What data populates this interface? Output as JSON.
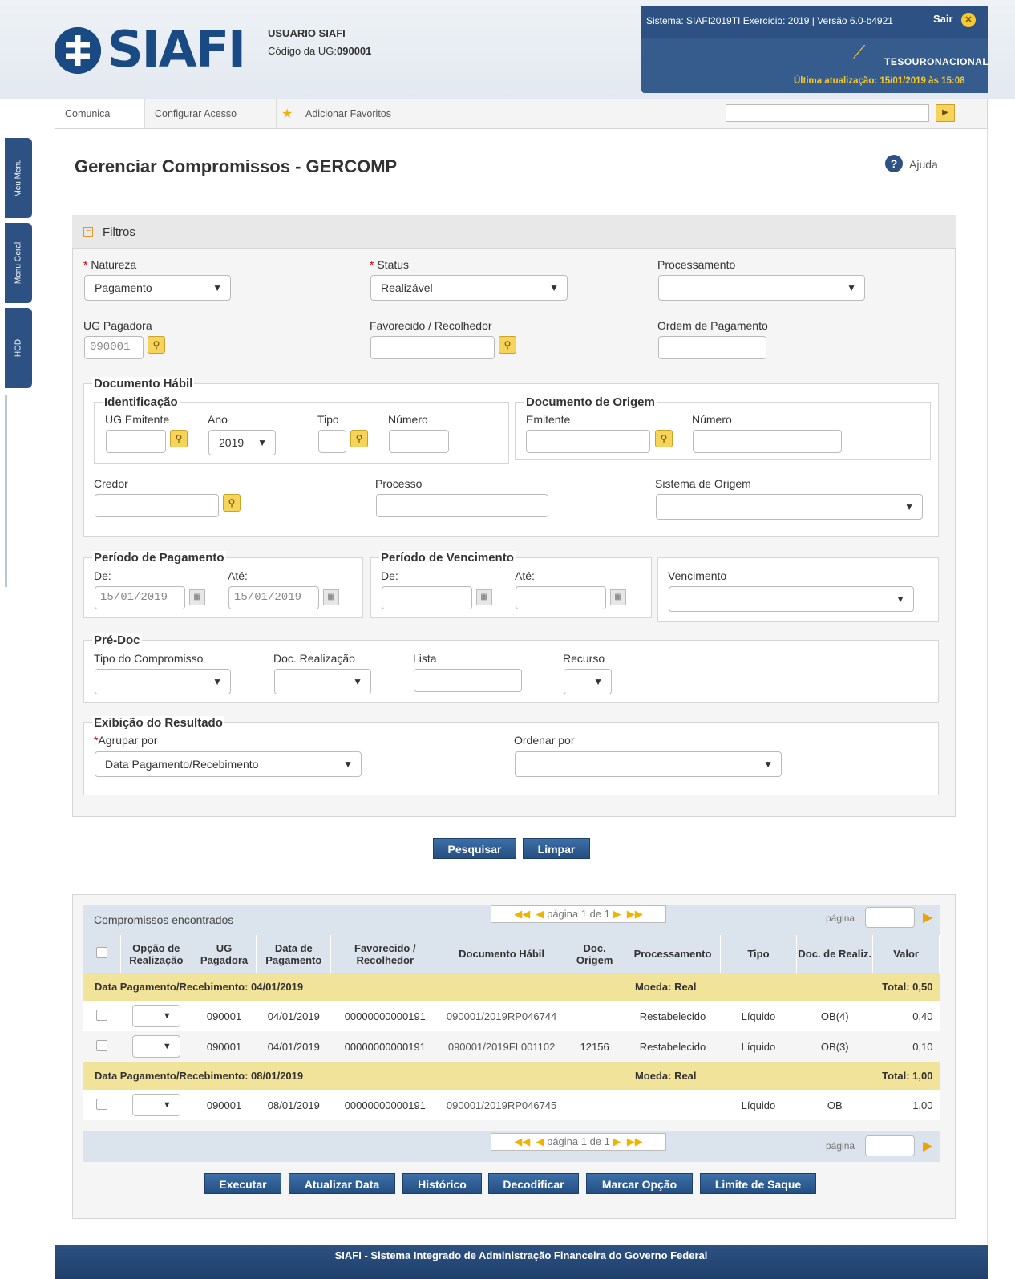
{
  "header": {
    "user": "USUARIO SIAFI",
    "ug_label": "Código da UG:",
    "ug_value": "090001",
    "system_line": "Sistema: SIAFI2019TI Exercício: 2019 | Versão 6.0-b4921",
    "exit_label": "Sair",
    "tesouro": "TESOURONACIONAL",
    "last_update": "Última atualização: 15/01/2019 às 15:08",
    "logo": "SIAFI"
  },
  "nav": {
    "items": [
      "Comunica",
      "Configurar Acesso",
      "Adicionar Favoritos"
    ]
  },
  "sidetabs": [
    "Meu Menu",
    "Menu Geral",
    "HOD"
  ],
  "page": {
    "title": "Gerenciar Compromissos - GERCOMP",
    "help": "Ajuda"
  },
  "filters": {
    "section": "Filtros",
    "natureza_label": "Natureza",
    "natureza_value": "Pagamento",
    "status_label": "Status",
    "status_value": "Realizável",
    "processamento_label": "Processamento",
    "ug_pagadora_label": "UG Pagadora",
    "ug_pagadora_value": "090001",
    "favorecido_label": "Favorecido / Recolhedor",
    "ordem_label": "Ordem de Pagamento",
    "doc_habil": "Documento Hábil",
    "identificacao": "Identificação",
    "ug_emitente_label": "UG Emitente",
    "ano_label": "Ano",
    "ano_value": "2019",
    "tipo_label": "Tipo",
    "numero_label": "Número",
    "doc_origem": "Documento de Origem",
    "emitente_label": "Emitente",
    "numero2_label": "Número",
    "credor_label": "Credor",
    "processo_label": "Processo",
    "sistema_origem_label": "Sistema de Origem",
    "periodo_pag": "Período de Pagamento",
    "de_label": "De:",
    "ate_label": "Até:",
    "pag_de_value": "15/01/2019",
    "pag_ate_value": "15/01/2019",
    "periodo_venc": "Período de Vencimento",
    "venc_de_label": "De:",
    "venc_ate_label": "Até:",
    "vencimento_label": "Vencimento",
    "predoc": "Pré-Doc",
    "tipo_comp_label": "Tipo do Compromisso",
    "doc_real_label": "Doc. Realização",
    "lista_label": "Lista",
    "recurso_label": "Recurso",
    "exibicao": "Exibição do Resultado",
    "agrupar_label": "Agrupar por",
    "agrupar_value": "Data Pagamento/Recebimento",
    "ordenar_label": "Ordenar por"
  },
  "actions": {
    "pesquisar": "Pesquisar",
    "limpar": "Limpar"
  },
  "results": {
    "title": "Compromissos encontrados",
    "pagination_text": "página 1 de 1",
    "page_label": "página",
    "columns": [
      "Opção de Realização",
      "UG Pagadora",
      "Data de Pagamento",
      "Favorecido / Recolhedor",
      "Documento Hábil",
      "Doc. Origem",
      "Processamento",
      "Tipo",
      "Doc. de Realiz.",
      "Valor"
    ],
    "groups": [
      {
        "label": "Data Pagamento/Recebimento: 04/01/2019",
        "moeda": "Moeda: Real",
        "total": "Total: 0,50",
        "rows": [
          {
            "ug": "090001",
            "data": "04/01/2019",
            "fav": "00000000000191",
            "doc": "090001/2019RP046744",
            "origem": "",
            "proc": "Restabelecido",
            "tipo": "Líquido",
            "real": "OB(4)",
            "valor": "0,40"
          },
          {
            "ug": "090001",
            "data": "04/01/2019",
            "fav": "00000000000191",
            "doc": "090001/2019FL001102",
            "origem": "12156",
            "proc": "Restabelecido",
            "tipo": "Líquido",
            "real": "OB(3)",
            "valor": "0,10"
          }
        ]
      },
      {
        "label": "Data Pagamento/Recebimento: 08/01/2019",
        "moeda": "Moeda: Real",
        "total": "Total: 1,00",
        "rows": [
          {
            "ug": "090001",
            "data": "08/01/2019",
            "fav": "00000000000191",
            "doc": "090001/2019RP046745",
            "origem": "",
            "proc": "",
            "tipo": "Líquido",
            "real": "OB",
            "valor": "1,00"
          }
        ]
      }
    ]
  },
  "bottom_actions": [
    "Executar",
    "Atualizar Data",
    "Histórico",
    "Decodificar",
    "Marcar Opção",
    "Limite de Saque"
  ],
  "footer": "SIAFI - Sistema Integrado de Administração Financeira do Governo Federal"
}
